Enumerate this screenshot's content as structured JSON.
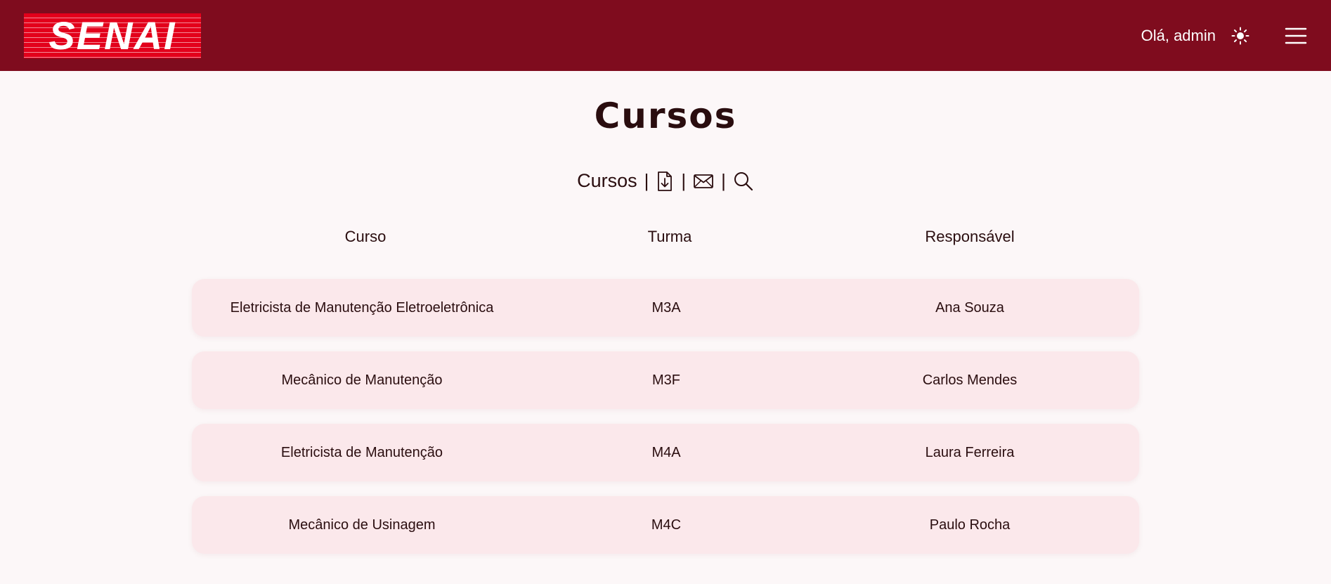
{
  "header": {
    "logo_text": "SENAI",
    "greeting": "Olá, admin",
    "theme_icon": "sun-icon",
    "menu_icon": "hamburger-menu-icon"
  },
  "main": {
    "title": "Cursos",
    "toolbar": {
      "label": "Cursos",
      "separator": "|",
      "icons": [
        "download-file-icon",
        "mail-icon",
        "search-icon"
      ]
    },
    "table": {
      "headers": [
        "Curso",
        "Turma",
        "Responsável"
      ],
      "rows": [
        [
          "Eletricista de Manutenção Eletroeletrônica",
          "M3A",
          "Ana Souza"
        ],
        [
          "Mecânico de Manutenção",
          "M3F",
          "Carlos Mendes"
        ],
        [
          "Eletricista de Manutenção",
          "M4A",
          "Laura Ferreira"
        ],
        [
          "Mecânico de Usinagem",
          "M4C",
          "Paulo Rocha"
        ]
      ]
    }
  },
  "colors": {
    "header_bg": "#7f0c1e",
    "logo_bg": "#e3001b",
    "page_bg": "#fcf7f8",
    "row_bg": "#fbe8eb",
    "text": "#2a0d0f"
  }
}
